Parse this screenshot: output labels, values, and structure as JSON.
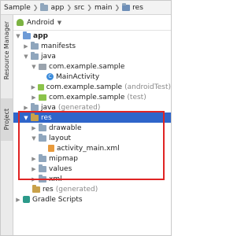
{
  "breadcrumb": [
    {
      "label": "Sample",
      "icon": "folder-icon"
    },
    {
      "label": "app",
      "icon": "folder-icon"
    },
    {
      "label": "src",
      "icon": "folder-icon"
    },
    {
      "label": "main",
      "icon": "folder-icon"
    },
    {
      "label": "res",
      "icon": "res-folder-icon"
    }
  ],
  "side_tabs": {
    "resource_manager": "Resource Manager",
    "project": "Project"
  },
  "toolbar": {
    "view_selector": "Android"
  },
  "tree": [
    {
      "label": "app",
      "suffix": ""
    },
    {
      "label": "manifests",
      "suffix": ""
    },
    {
      "label": "java",
      "suffix": ""
    },
    {
      "label": "com.example.sample",
      "suffix": ""
    },
    {
      "label": "MainActivity",
      "suffix": ""
    },
    {
      "label": "com.example.sample",
      "suffix": "(androidTest)"
    },
    {
      "label": "com.example.sample",
      "suffix": "(test)"
    },
    {
      "label": "java",
      "suffix": "(generated)"
    },
    {
      "label": "res",
      "suffix": ""
    },
    {
      "label": "drawable",
      "suffix": ""
    },
    {
      "label": "layout",
      "suffix": ""
    },
    {
      "label": "activity_main.xml",
      "suffix": ""
    },
    {
      "label": "mipmap",
      "suffix": ""
    },
    {
      "label": "values",
      "suffix": ""
    },
    {
      "label": "xml",
      "suffix": ""
    },
    {
      "label": "res",
      "suffix": "(generated)"
    },
    {
      "label": "Gradle Scripts",
      "suffix": ""
    }
  ],
  "colors": {
    "selection": "#2f65ca",
    "highlight_box": "#e02424"
  }
}
